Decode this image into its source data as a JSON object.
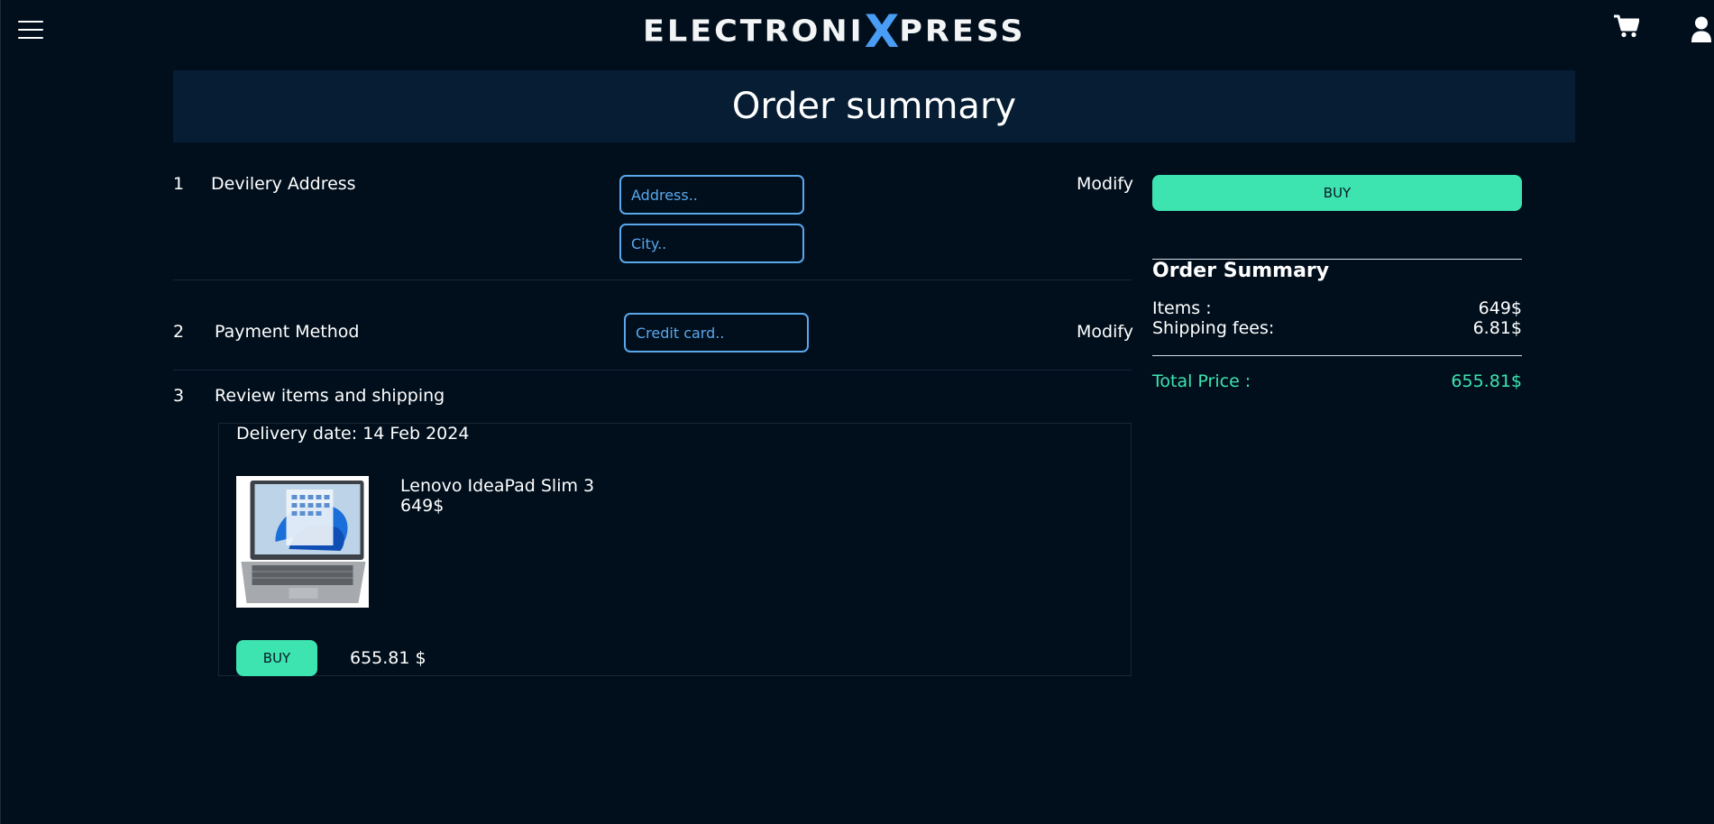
{
  "header": {
    "logo_prefix": "ELECTRONI",
    "logo_x": "X",
    "logo_suffix": "PRESS"
  },
  "title": "Order summary",
  "sections": {
    "address": {
      "number": "1",
      "title": "Devilery Address",
      "address_placeholder": "Address..",
      "city_placeholder": "City..",
      "modify_label": "Modify"
    },
    "payment": {
      "number": "2",
      "title": "Payment Method",
      "card_placeholder": "Credit card..",
      "modify_label": "Modify"
    },
    "review": {
      "number": "3",
      "title": "Review items and shipping",
      "delivery_date": "Delivery date: 14 Feb 2024",
      "product_name": "Lenovo IdeaPad Slim 3",
      "product_price": "649$",
      "buy_label": "BUY",
      "total": "655.81 $"
    }
  },
  "summary": {
    "buy_label": "BUY",
    "title": "Order Summary",
    "items_label": "Items :",
    "items_value": "649$",
    "shipping_label": "Shipping fees:",
    "shipping_value": "6.81$",
    "total_label": "Total Price :",
    "total_value": "655.81$"
  },
  "colors": {
    "background": "#010f1c",
    "accent_green": "#3ee4b0",
    "accent_blue": "#4a9df5",
    "title_band": "#061d33"
  },
  "icons": {
    "menu": "hamburger-menu-icon",
    "cart": "shopping-cart-icon",
    "user": "user-icon"
  }
}
